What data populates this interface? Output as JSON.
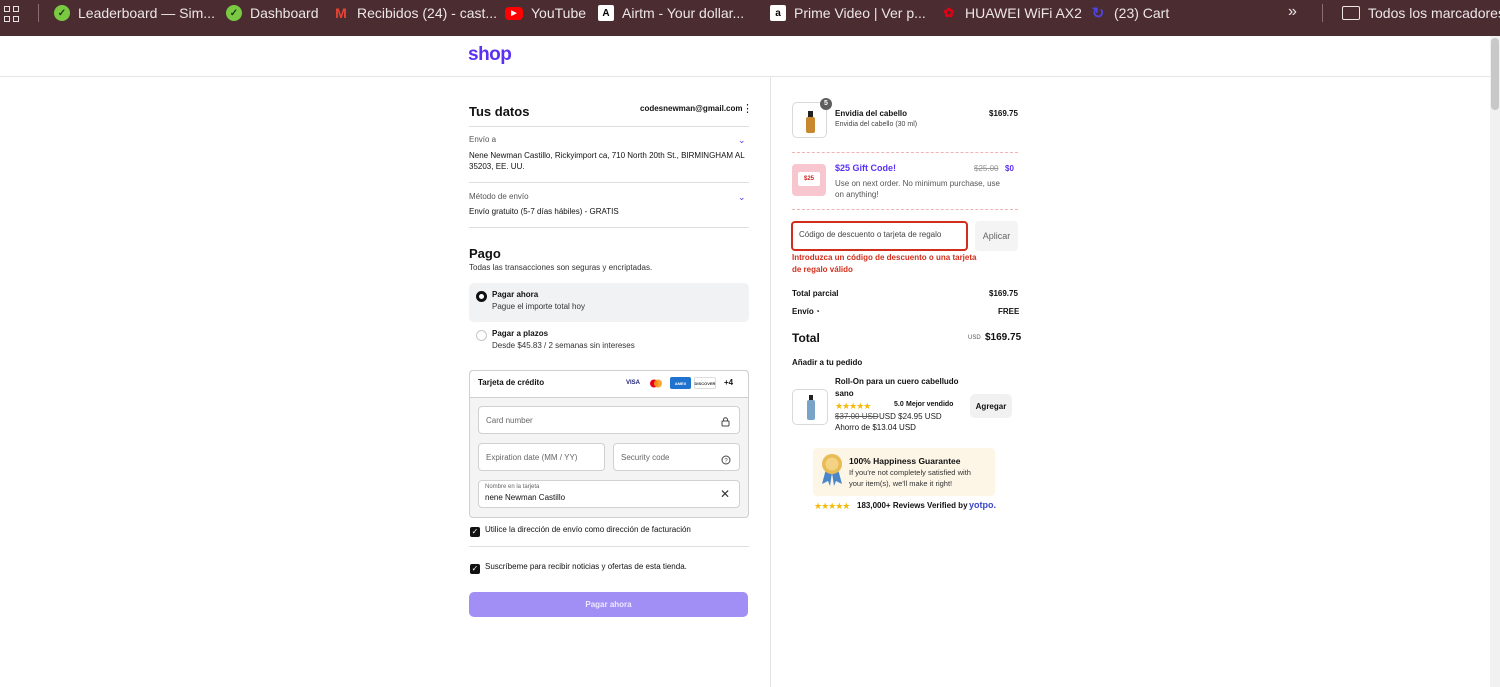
{
  "bookmarks": {
    "items": [
      {
        "label": "Leaderboard — Sim...",
        "icon": "leaderboard-icon"
      },
      {
        "label": "Dashboard",
        "icon": "dashboard-icon"
      },
      {
        "label": "Recibidos (24) - cast...",
        "icon": "gmail-icon"
      },
      {
        "label": "YouTube",
        "icon": "youtube-icon"
      },
      {
        "label": "Airtm - Your dollar...",
        "icon": "airtm-icon"
      },
      {
        "label": "Prime Video | Ver p...",
        "icon": "amazon-icon"
      },
      {
        "label": "HUAWEI WiFi AX2",
        "icon": "huawei-icon"
      },
      {
        "label": "(23) Cart",
        "icon": "cart-icon"
      }
    ],
    "more": "»",
    "folder_label": "Todos los marcadores"
  },
  "header": {
    "logo": "shop"
  },
  "details": {
    "title": "Tus datos",
    "email": "codesnewman@gmail.com",
    "ship_to_label": "Envío a",
    "ship_to_line1": "Nene Newman Castillo, Rickyimport ca, 710 North 20th St., BIRMINGHAM AL",
    "ship_to_line2": "35203, EE. UU.",
    "method_label": "Método de envío",
    "method_value": "Envío gratuito (5-7 días hábiles) - GRATIS"
  },
  "payment": {
    "title": "Pago",
    "subtitle": "Todas las transacciones son seguras y encriptadas.",
    "options": [
      {
        "title": "Pagar ahora",
        "desc": "Pague el importe total hoy",
        "selected": true
      },
      {
        "title": "Pagar a plazos",
        "desc": "Desde $45.83 / 2 semanas sin intereses",
        "selected": false
      }
    ],
    "card_title": "Tarjeta de crédito",
    "brands": [
      "VISA",
      "AMEX",
      "DISCOVER"
    ],
    "brands_more": "+4",
    "card_number_placeholder": "Card number",
    "expiry_placeholder": "Expiration date (MM / YY)",
    "security_placeholder": "Security code",
    "name_label": "Nombre en la tarjeta",
    "name_value": "nene Newman Castillo",
    "billing_checkbox": "Utilice la dirección de envío como dirección de facturación",
    "subscribe_checkbox": "Suscríbeme para recibir noticias y ofertas de esta tienda.",
    "pay_button": "Pagar ahora"
  },
  "summary": {
    "product": {
      "name": "Envidia del cabello",
      "variant": "Envidia del cabello (30 ml)",
      "price": "$169.75",
      "qty": "5"
    },
    "gift": {
      "title": "$25 Gift Code!",
      "desc1": "Use on next order. No minimum purchase, use",
      "desc2": "on anything!",
      "old_price": "$25.00",
      "new_price": "$0",
      "img_text": "$25"
    },
    "discount_placeholder": "Código de descuento o tarjeta de regalo",
    "apply_button": "Aplicar",
    "error1": "Introduzca un código de descuento o una tarjeta",
    "error2": "de regalo válido",
    "subtotal_label": "Total parcial",
    "subtotal_value": "$169.75",
    "shipping_label": "Envío",
    "shipping_value": "FREE",
    "total_label": "Total",
    "total_currency": "USD",
    "total_value": "$169.75",
    "upsell_title": "Añadir a tu pedido",
    "upsell": {
      "name1": "Roll-On para un cuero cabelludo",
      "name2": "sano",
      "rating": "5.0",
      "badge": "Mejor vendido",
      "old_price": "$37.00 USD",
      "new_price": "USD $24.95 USD",
      "savings": "Ahorro de $13.04 USD",
      "button": "Agregar"
    },
    "guarantee": {
      "title": "100% Happiness Guarantee",
      "line1": "If you're not completely satisfied with",
      "line2": "your item(s), we'll make it right!"
    },
    "reviews": "183,000+ Reviews Verified by",
    "reviews_brand": "yotpo."
  },
  "colors": {
    "brand": "#5a31f4",
    "error": "#d12f1c",
    "pay_button": "#a18ff6",
    "bookmark_bar": "#4a2c31"
  }
}
